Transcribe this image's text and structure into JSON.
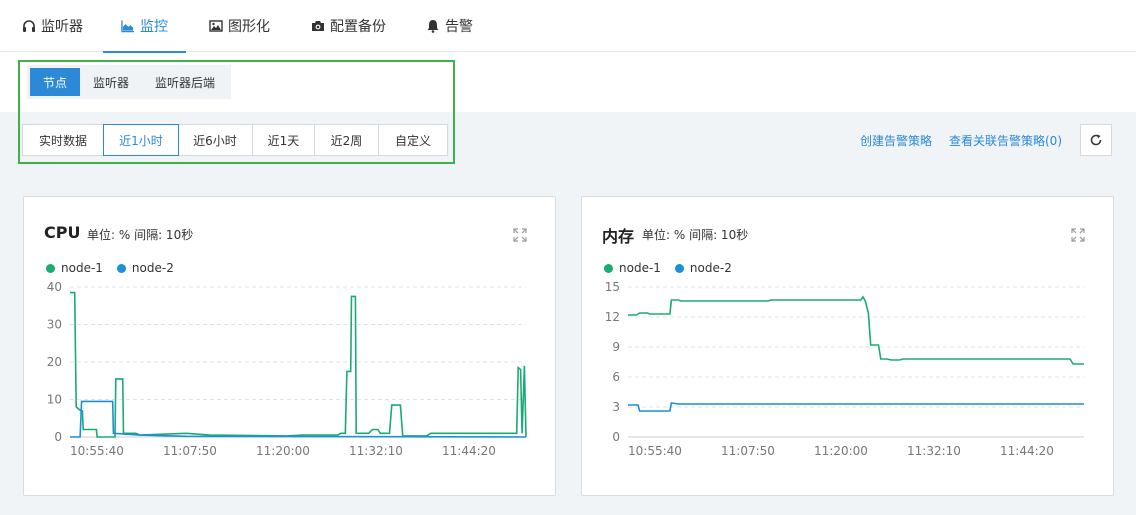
{
  "nav": {
    "tabs": [
      {
        "label": "监听器",
        "icon": "headphones-icon"
      },
      {
        "label": "监控",
        "icon": "area-chart-icon"
      },
      {
        "label": "图形化",
        "icon": "image-icon"
      },
      {
        "label": "配置备份",
        "icon": "camera-icon"
      },
      {
        "label": "告警",
        "icon": "bell-icon"
      }
    ],
    "active": "监控"
  },
  "subtabs": {
    "items": [
      "节点",
      "监听器",
      "监听器后端"
    ],
    "active": "节点"
  },
  "range": {
    "items": [
      "实时数据",
      "近1小时",
      "近6小时",
      "近1天",
      "近2周",
      "自定义"
    ],
    "active": "近1小时"
  },
  "actions": {
    "create_policy": "创建告警策略",
    "view_policies": "查看关联告警策略(0)",
    "refresh_icon": "refresh-icon"
  },
  "colors": {
    "accent": "#2b89d8",
    "node1": "#1aab73",
    "node2": "#1b8fd8",
    "highlight": "#3eb14d"
  },
  "charts": [
    {
      "title": "CPU",
      "meta": "单位: % 间隔: 10秒"
    },
    {
      "title": "内存",
      "meta": "单位: % 间隔: 10秒"
    }
  ],
  "chart_data": [
    {
      "type": "line",
      "title": "CPU",
      "unit": "%",
      "x_ticks": [
        "10:55:40",
        "11:07:50",
        "11:20:00",
        "11:32:10",
        "11:44:20"
      ],
      "ylim": [
        0,
        40
      ],
      "y_ticks": [
        0,
        10,
        20,
        30,
        40
      ],
      "grid": true,
      "legend": "top-left",
      "series": [
        {
          "name": "node-1",
          "color": "#1aab73",
          "points": [
            [
              0,
              38.5
            ],
            [
              0.6,
              38.5
            ],
            [
              0.8,
              8
            ],
            [
              1.4,
              7
            ],
            [
              1.6,
              7
            ],
            [
              1.7,
              2
            ],
            [
              3.4,
              2
            ],
            [
              3.5,
              0
            ],
            [
              5.8,
              0
            ],
            [
              5.9,
              15.5
            ],
            [
              6.8,
              15.5
            ],
            [
              6.9,
              1
            ],
            [
              8.5,
              1
            ],
            [
              9,
              0.5
            ],
            [
              15,
              1
            ],
            [
              18,
              0.5
            ],
            [
              28,
              0.3
            ],
            [
              30,
              0.5
            ],
            [
              34.5,
              0.5
            ],
            [
              34.9,
              1
            ],
            [
              35.5,
              1
            ],
            [
              35.7,
              17.5
            ],
            [
              36.2,
              17.5
            ],
            [
              36.3,
              37.5
            ],
            [
              36.8,
              37.5
            ],
            [
              36.9,
              1
            ],
            [
              38.5,
              1
            ],
            [
              39,
              2
            ],
            [
              39.7,
              2
            ],
            [
              40,
              1
            ],
            [
              41.2,
              1
            ],
            [
              41.5,
              8.5
            ],
            [
              42.6,
              8.5
            ],
            [
              42.9,
              0.3
            ],
            [
              46,
              0.3
            ],
            [
              46.5,
              1
            ],
            [
              57,
              1
            ],
            [
              57.6,
              1
            ],
            [
              57.8,
              18.5
            ],
            [
              58.1,
              18
            ],
            [
              58.3,
              1
            ],
            [
              58.6,
              19
            ],
            [
              58.8,
              0
            ]
          ]
        },
        {
          "name": "node-2",
          "color": "#1b8fd8",
          "points": [
            [
              0,
              0
            ],
            [
              1.3,
              0
            ],
            [
              1.5,
              9.5
            ],
            [
              5.5,
              9.5
            ],
            [
              5.6,
              1
            ],
            [
              9,
              0.5
            ],
            [
              15,
              0.2
            ],
            [
              58.8,
              0
            ]
          ]
        }
      ]
    },
    {
      "type": "line",
      "title": "内存",
      "unit": "%",
      "x_ticks": [
        "10:55:40",
        "11:07:50",
        "11:20:00",
        "11:32:10",
        "11:44:20"
      ],
      "ylim": [
        0,
        15
      ],
      "y_ticks": [
        0,
        3,
        6,
        9,
        12,
        15
      ],
      "grid": true,
      "legend": "top-left",
      "series": [
        {
          "name": "node-1",
          "color": "#1aab73",
          "points": [
            [
              0,
              12.2
            ],
            [
              1.1,
              12.2
            ],
            [
              1.5,
              12.4
            ],
            [
              2.5,
              12.4
            ],
            [
              2.8,
              12.3
            ],
            [
              5.4,
              12.3
            ],
            [
              5.6,
              13.7
            ],
            [
              6.5,
              13.7
            ],
            [
              6.8,
              13.6
            ],
            [
              18,
              13.6
            ],
            [
              18.5,
              13.7
            ],
            [
              30,
              13.7
            ],
            [
              30.3,
              14
            ],
            [
              30.6,
              13.6
            ],
            [
              31,
              12.4
            ],
            [
              31.3,
              9.2
            ],
            [
              32.3,
              9.2
            ],
            [
              32.6,
              7.8
            ],
            [
              33.4,
              7.8
            ],
            [
              34,
              7.7
            ],
            [
              35,
              7.7
            ],
            [
              35.5,
              7.8
            ],
            [
              57,
              7.8
            ],
            [
              57.4,
              7.3
            ],
            [
              58.8,
              7.3
            ]
          ]
        },
        {
          "name": "node-2",
          "color": "#1b8fd8",
          "points": [
            [
              0,
              3.2
            ],
            [
              1.3,
              3.2
            ],
            [
              1.5,
              2.6
            ],
            [
              5.4,
              2.6
            ],
            [
              5.6,
              3.4
            ],
            [
              6.5,
              3.3
            ],
            [
              58.8,
              3.3
            ]
          ]
        }
      ]
    }
  ]
}
